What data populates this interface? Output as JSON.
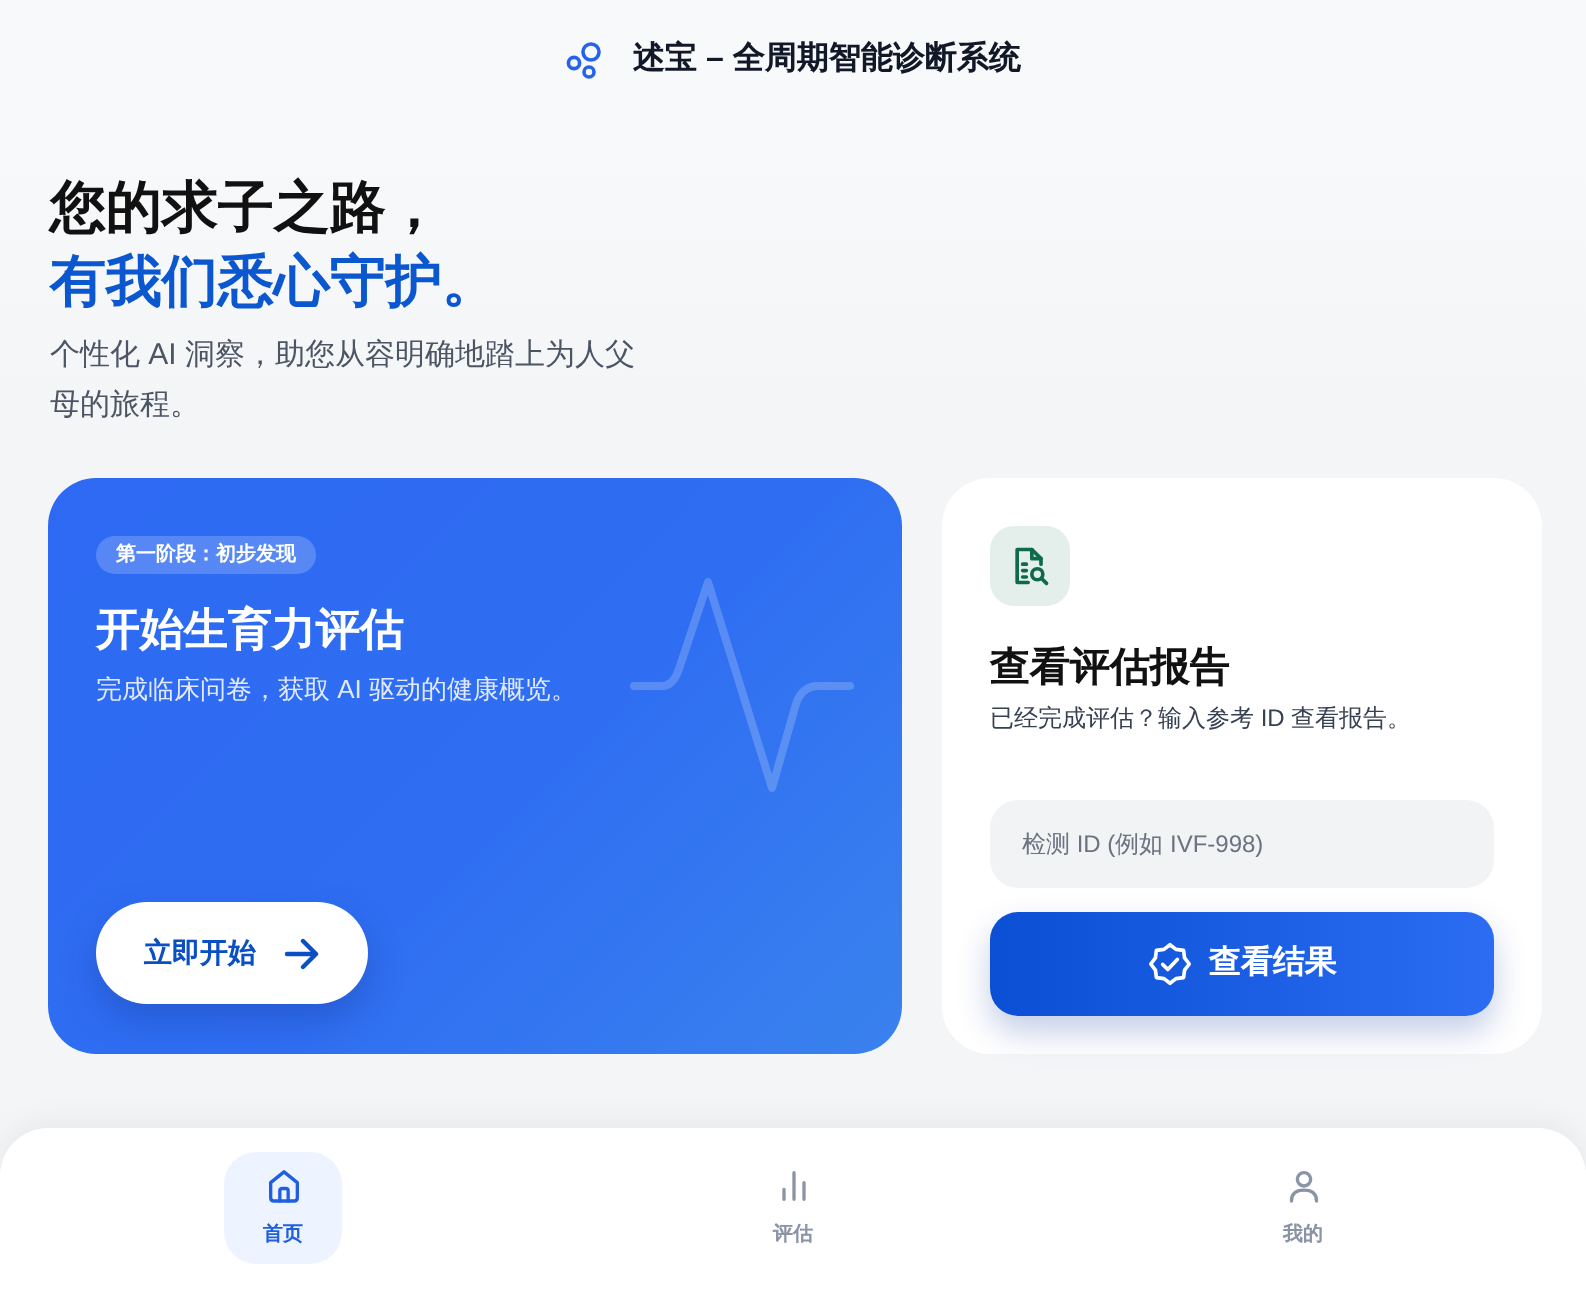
{
  "header": {
    "title": "述宝 – 全周期智能诊断系统"
  },
  "hero": {
    "headline": "您的求子之路，",
    "headline_accent": "有我们悉心守护。",
    "subtitle": "个性化 AI 洞察，助您从容明确地踏上为人父母的旅程。"
  },
  "start_card": {
    "badge": "第一阶段：初步发现",
    "title": "开始生育力评估",
    "description": "完成临床问卷，获取 AI 驱动的健康概览。",
    "button": "立即开始"
  },
  "report_card": {
    "title": "查看评估报告",
    "description": "已经完成评估？输入参考 ID 查看报告。",
    "input": {
      "placeholder": "检测 ID (例如 IVF-998)"
    },
    "button": "查看结果"
  },
  "bottom_nav": [
    {
      "label": "首页",
      "selected": true
    },
    {
      "label": "评估",
      "selected": false
    },
    {
      "label": "我的",
      "selected": false
    }
  ]
}
